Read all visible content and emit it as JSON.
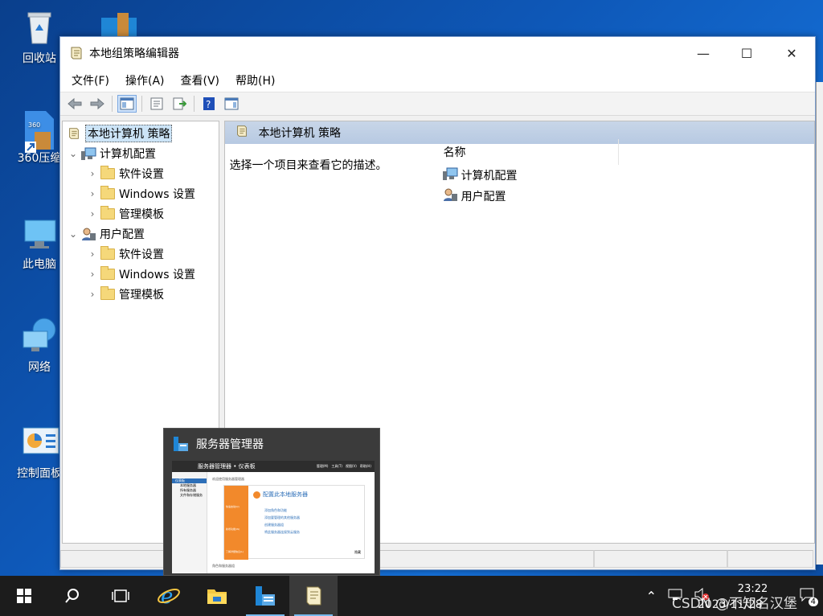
{
  "desktop": {
    "icons": [
      {
        "label": "回收站"
      },
      {
        "label": "360压缩"
      },
      {
        "label": "此电脑"
      },
      {
        "label": "网络"
      },
      {
        "label": "控制面板"
      }
    ]
  },
  "window": {
    "title": "本地组策略编辑器",
    "controls": {
      "minimize": "—",
      "maximize": "☐",
      "close": "✕"
    },
    "menu": [
      "文件(F)",
      "操作(A)",
      "查看(V)",
      "帮助(H)"
    ],
    "tree": [
      {
        "label": "本地计算机 策略",
        "selected": true
      },
      {
        "label": "计算机配置",
        "expander": "⌄"
      },
      {
        "label": "软件设置",
        "expander": "›"
      },
      {
        "label": "Windows 设置",
        "expander": "›"
      },
      {
        "label": "管理模板",
        "expander": "›"
      },
      {
        "label": "用户配置",
        "expander": "⌄"
      },
      {
        "label": "软件设置",
        "expander": "›"
      },
      {
        "label": "Windows 设置",
        "expander": "›"
      },
      {
        "label": "管理模板",
        "expander": "›"
      }
    ],
    "right": {
      "header": "本地计算机 策略",
      "description": "选择一个项目来查看它的描述。",
      "column_name": "名称",
      "items": [
        "计算机配置",
        "用户配置"
      ]
    }
  },
  "thumbnail": {
    "title": "服务器管理器",
    "breadcrumb": "服务器管理器 • 仪表板",
    "welcome": "欢迎使用服务器管理器",
    "quick_start": "快速启动(Q)",
    "new_features": "新增功能(W)",
    "learn_more": "了解详细信息(L)",
    "configure": "配置此本地服务器",
    "steps": [
      "添加角色和功能",
      "添加要管理的其他服务器",
      "创建服务器组",
      "将此服务器连接到云服务"
    ],
    "nav": [
      "仪表板",
      "本地服务器",
      "所有服务器",
      "文件和存储服务"
    ],
    "hide": "隐藏",
    "roles": "角色和服务器组",
    "menu": [
      "管理(M)",
      "工具(T)",
      "视图(V)",
      "帮助(H)"
    ]
  },
  "taskbar": {
    "time": "23:22",
    "date": "2023/11/28",
    "notification_count": "4",
    "watermark": "CSDN @不知名汉堡"
  }
}
